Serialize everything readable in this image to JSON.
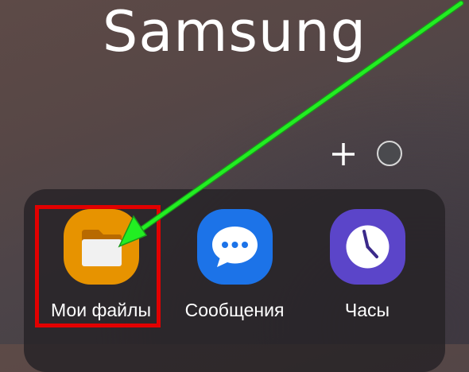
{
  "folder": {
    "title": "Samsung"
  },
  "controls": {
    "add_icon": "plus-icon",
    "color_icon": "circle-color-icon"
  },
  "apps": [
    {
      "label": "Мои файлы",
      "icon": "folder-icon",
      "color": "#e79300"
    },
    {
      "label": "Сообщения",
      "icon": "chat-bubble-icon",
      "color": "#1c73e8"
    },
    {
      "label": "Часы",
      "icon": "clock-icon",
      "color": "#5b45c9"
    }
  ],
  "annotation": {
    "highlight_color": "#e20000",
    "arrow_color": "#22ee22"
  }
}
